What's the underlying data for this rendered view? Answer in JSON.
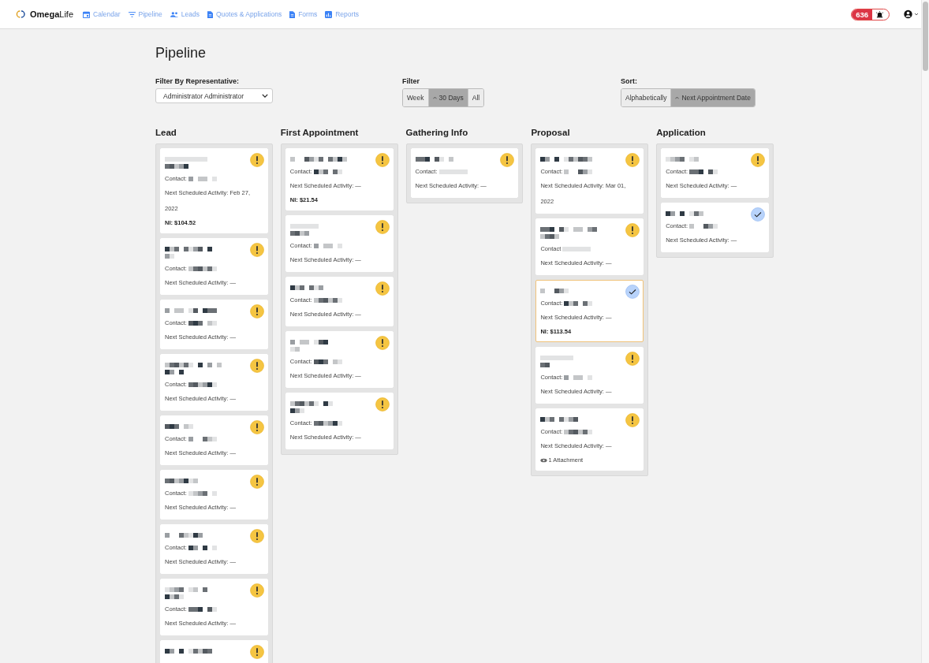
{
  "nav": {
    "brand_prefix": "Omega",
    "brand_suffix": "Life",
    "links": [
      {
        "label": "Calendar"
      },
      {
        "label": "Pipeline"
      },
      {
        "label": "Leads"
      },
      {
        "label": "Quotes & Applications"
      },
      {
        "label": "Forms"
      },
      {
        "label": "Reports"
      }
    ],
    "alert_count": "636"
  },
  "page_title": "Pipeline",
  "rep_filter": {
    "label": "Filter By Representative:",
    "value": "Administrator Administrator"
  },
  "filter": {
    "label": "Filter",
    "options": [
      {
        "label": "Week",
        "selected": false
      },
      {
        "label": "30 Days",
        "selected": true
      },
      {
        "label": "All",
        "selected": false
      }
    ]
  },
  "sort": {
    "label": "Sort:",
    "options": [
      {
        "label": "Alphabetically",
        "selected": false
      },
      {
        "label": "Next Appointment Date",
        "selected": true
      }
    ]
  },
  "columns": [
    {
      "title": "Lead",
      "cards": [
        {
          "kind": "warning",
          "long_name": true,
          "highlighted": false,
          "contact_label": "Contact:",
          "activity": "Next Scheduled Activity: Feb 27, 2022",
          "ni": "NI: $104.52"
        },
        {
          "kind": "warning",
          "long_name": true,
          "highlighted": false,
          "contact_label": "Contact:",
          "activity": "Next Scheduled Activity: —"
        },
        {
          "kind": "warning",
          "long_name": false,
          "highlighted": false,
          "contact_label": "Contact:",
          "activity": "Next Scheduled Activity: —"
        },
        {
          "kind": "warning",
          "long_name": true,
          "highlighted": false,
          "contact_label": "Contact:",
          "activity": "Next Scheduled Activity: —"
        },
        {
          "kind": "warning",
          "long_name": false,
          "highlighted": false,
          "contact_label": "Contact:",
          "activity": "Next Scheduled Activity: —"
        },
        {
          "kind": "warning",
          "long_name": false,
          "highlighted": false,
          "contact_label": "Contact:",
          "activity": "Next Scheduled Activity: —"
        },
        {
          "kind": "warning",
          "long_name": false,
          "highlighted": false,
          "contact_label": "Contact:",
          "activity": "Next Scheduled Activity: —"
        },
        {
          "kind": "warning",
          "long_name": true,
          "highlighted": false,
          "contact_label": "Contact:",
          "activity": "Next Scheduled Activity: —"
        },
        {
          "kind": "warning",
          "highlighted": false
        }
      ]
    },
    {
      "title": "First Appointment",
      "cards": [
        {
          "kind": "warning",
          "long_name": false,
          "highlighted": false,
          "contact_label": "Contact:",
          "activity": "Next Scheduled Activity: —",
          "ni": "NI: $21.54"
        },
        {
          "kind": "warning",
          "long_name": true,
          "highlighted": false,
          "contact_label": "Contact:",
          "activity": "Next Scheduled Activity: —"
        },
        {
          "kind": "warning",
          "long_name": false,
          "highlighted": false,
          "contact_label": "Contact:",
          "activity": "Next Scheduled Activity: —"
        },
        {
          "kind": "warning",
          "long_name": true,
          "highlighted": false,
          "contact_label": "Contact:",
          "activity": "Next Scheduled Activity: —"
        },
        {
          "kind": "warning",
          "long_name": true,
          "highlighted": false,
          "contact_label": "Contact:",
          "activity": "Next Scheduled Activity: —"
        }
      ]
    },
    {
      "title": "Gathering Info",
      "cards": [
        {
          "kind": "warning",
          "long_name": false,
          "highlighted": false,
          "contact_label": "Contact:",
          "activity": "Next Scheduled Activity: —"
        }
      ]
    },
    {
      "title": "Proposal",
      "cards": [
        {
          "kind": "warning",
          "long_name": false,
          "highlighted": false,
          "contact_label": "Contact:",
          "activity": "Next Scheduled Activity: Mar 01, 2022"
        },
        {
          "kind": "warning",
          "long_name": true,
          "highlighted": false,
          "contact_label": "Contact",
          "activity": "Next Scheduled Activity: —"
        },
        {
          "kind": "done",
          "long_name": false,
          "highlighted": true,
          "contact_label": "Contact:",
          "activity": "Next Scheduled Activity: —",
          "ni": "NI: $113.54"
        },
        {
          "kind": "warning",
          "long_name": true,
          "highlighted": false,
          "contact_label": "Contact:",
          "activity": "Next Scheduled Activity: —"
        },
        {
          "kind": "warning",
          "long_name": false,
          "highlighted": false,
          "contact_label": "Contact:",
          "activity": "Next Scheduled Activity: —",
          "attachment": "1 Attachment"
        }
      ]
    },
    {
      "title": "Application",
      "cards": [
        {
          "kind": "warning",
          "long_name": false,
          "highlighted": false,
          "contact_label": "Contact:",
          "activity": "Next Scheduled Activity: —"
        },
        {
          "kind": "done",
          "long_name": false,
          "highlighted": false,
          "contact_label": "Contact:",
          "activity": "Next Scheduled Activity: —"
        }
      ]
    }
  ]
}
